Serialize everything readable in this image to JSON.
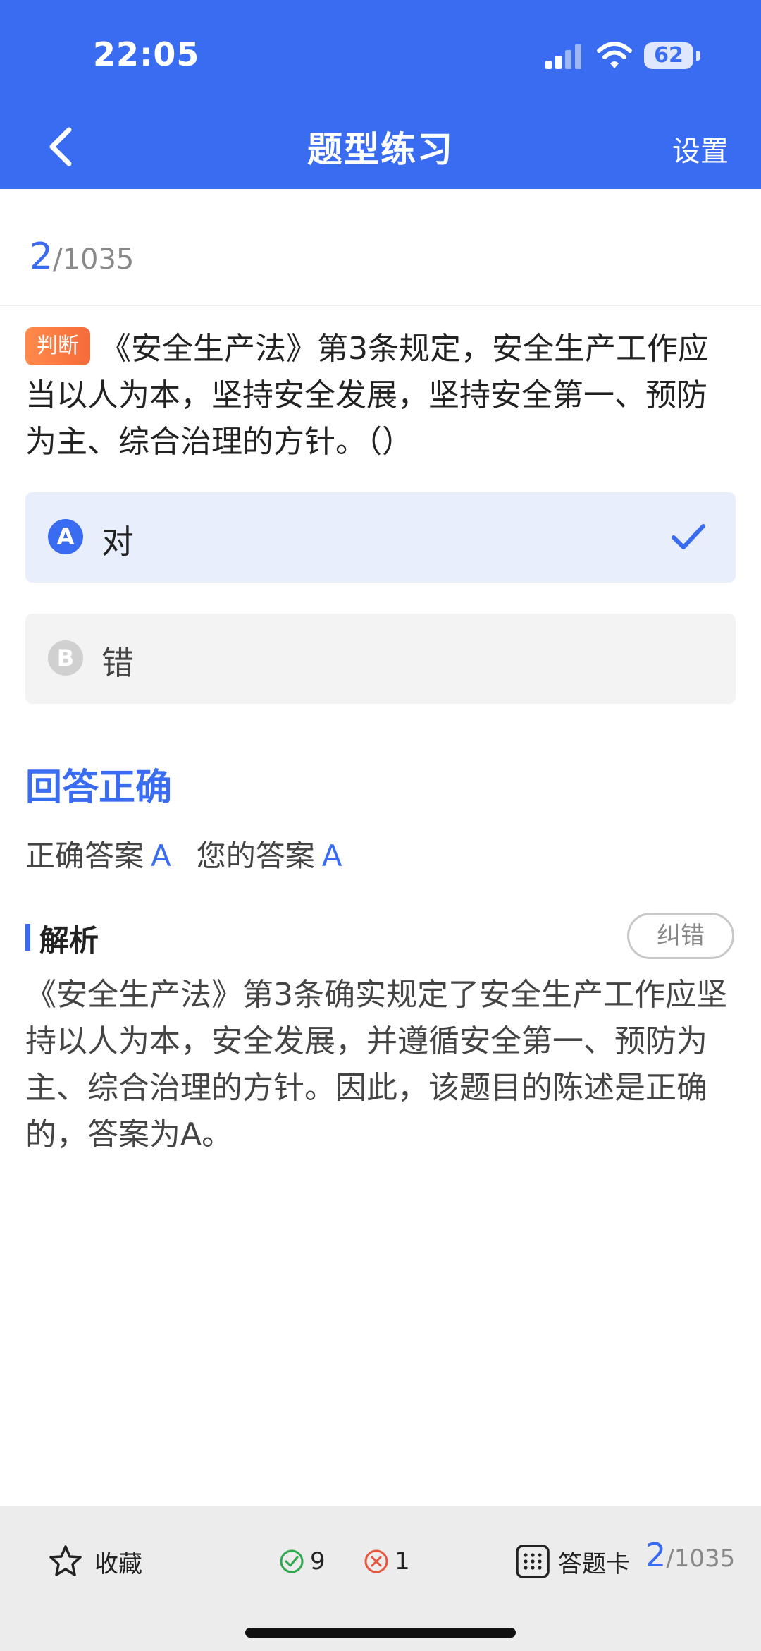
{
  "status_bar": {
    "time": "22:05",
    "battery": "62"
  },
  "header": {
    "title": "题型练习",
    "settings_label": "设置"
  },
  "progress": {
    "current": "2",
    "total": "/1035"
  },
  "question": {
    "type_tag": "判断",
    "text": "《安全生产法》第3条规定，安全生产工作应当以人为本，坚持安全发展，坚持安全第一、预防为主、综合治理的方针。（）"
  },
  "options": [
    {
      "letter": "A",
      "text": "对",
      "selected": true
    },
    {
      "letter": "B",
      "text": "错",
      "selected": false
    }
  ],
  "result": {
    "status": "回答正确",
    "correct_label": "正确答案",
    "correct_value": "A",
    "yours_label": "您的答案",
    "yours_value": "A"
  },
  "analysis": {
    "title": "解析",
    "report_label": "纠错",
    "text": "《安全生产法》第3条确实规定了安全生产工作应坚持以人为本，安全发展，并遵循安全第一、预防为主、综合治理的方针。因此，该题目的陈述是正确的，答案为A。"
  },
  "bottom_bar": {
    "favorite_label": "收藏",
    "right_count": "9",
    "wrong_count": "1",
    "card_label": "答题卡",
    "progress_current": "2",
    "progress_total": "/1035"
  },
  "colors": {
    "accent": "#3a6cf1",
    "tag": "#f66b3a",
    "correct": "#2fa84f",
    "wrong": "#e8553e"
  }
}
